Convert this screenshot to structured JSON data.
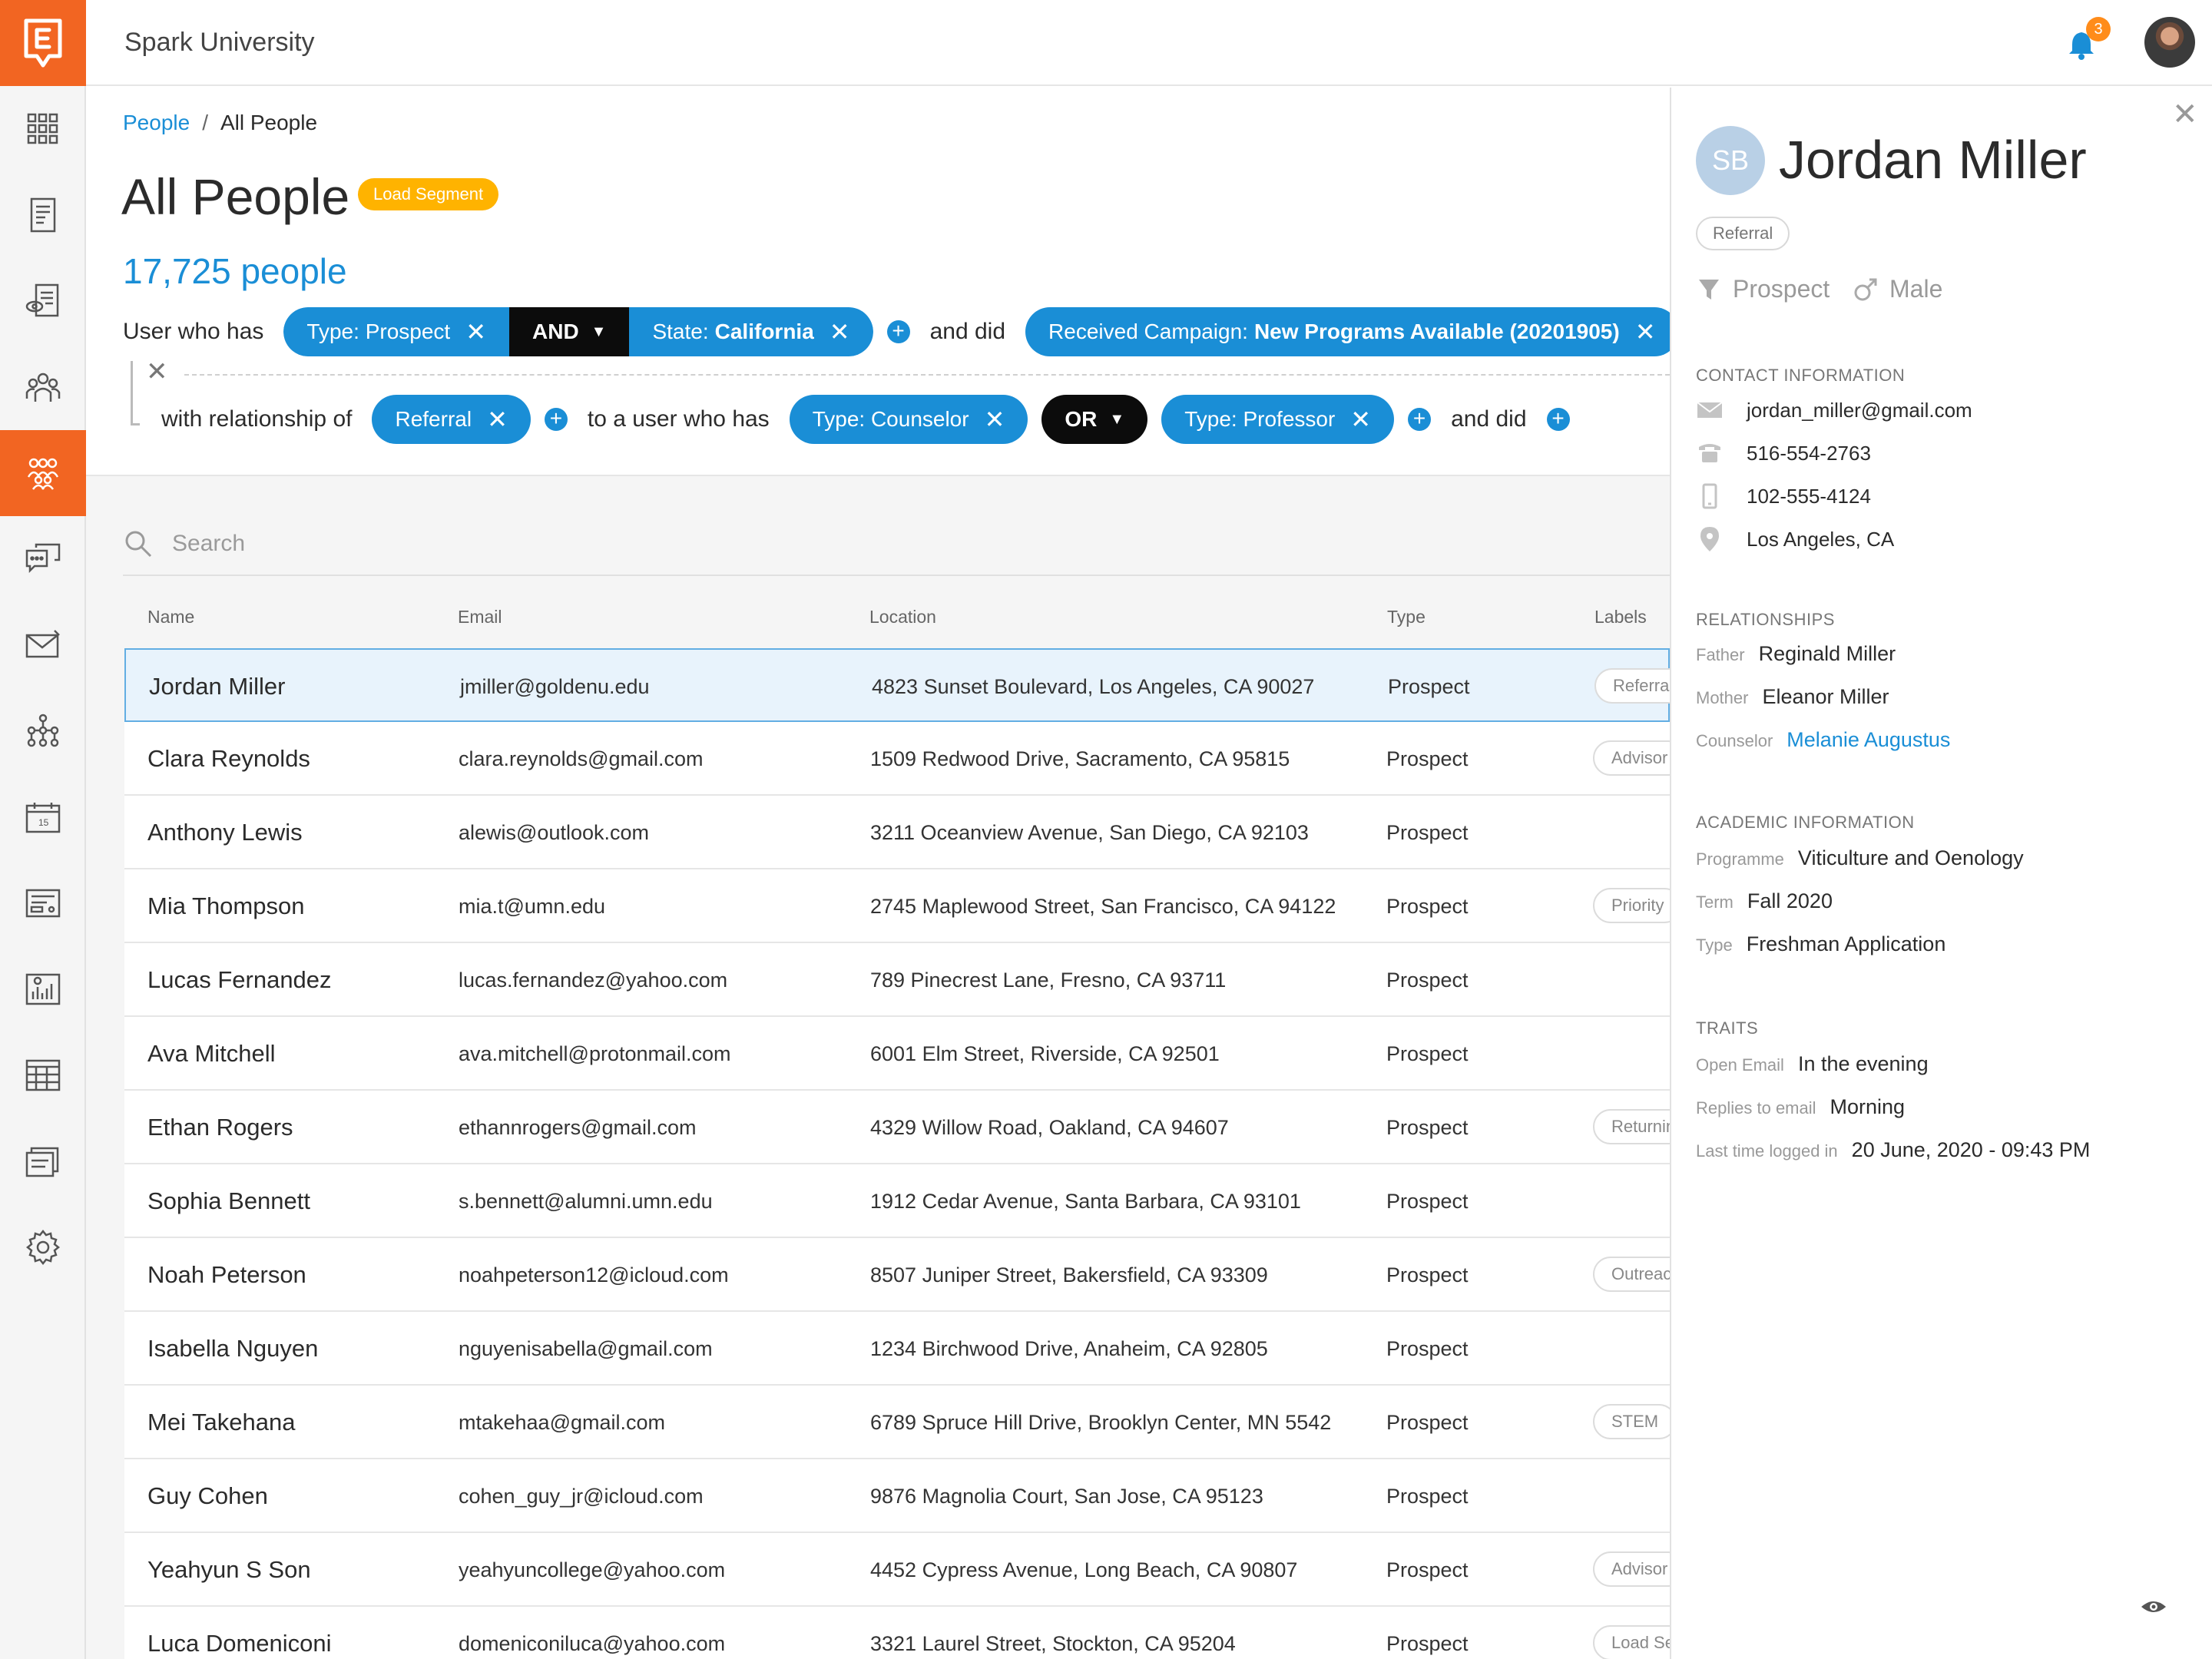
{
  "app": {
    "title": "Spark University",
    "notification_count": "3",
    "accent": "#f26522",
    "link_color": "#1a8ed6"
  },
  "sidebar": {
    "items": [
      {
        "icon": "grid-icon"
      },
      {
        "icon": "document-icon"
      },
      {
        "icon": "document-eye-icon"
      },
      {
        "icon": "team-icon"
      },
      {
        "icon": "people-icon",
        "active": true
      },
      {
        "icon": "chat-icon"
      },
      {
        "icon": "mail-icon"
      },
      {
        "icon": "hierarchy-icon"
      },
      {
        "icon": "calendar-icon"
      },
      {
        "icon": "form-icon"
      },
      {
        "icon": "chart-icon"
      },
      {
        "icon": "table-icon"
      },
      {
        "icon": "files-icon"
      },
      {
        "icon": "gear-icon"
      }
    ]
  },
  "breadcrumb": {
    "parent": "People",
    "separator": "/",
    "current": "All People"
  },
  "page": {
    "title": "All People",
    "load_segment": "Load Segment",
    "count": "17,725 people"
  },
  "filters": {
    "row1": {
      "prefix": "User who has",
      "chip1_key": "Type:",
      "chip1_val": "Prospect",
      "operator": "AND",
      "chip2_key": "State:",
      "chip2_val": "California",
      "and_did": "and did",
      "chip3_key": "Received Campaign:",
      "chip3_val": "New Programs Available (20201905)"
    },
    "row2": {
      "prefix": "with relationship of",
      "rel_chip": "Referral",
      "to_user": "to a user who has",
      "chip1_key": "Type:",
      "chip1_val": "Counselor",
      "operator": "OR",
      "chip2_key": "Type:",
      "chip2_val": "Professor",
      "and_did": "and did"
    }
  },
  "search": {
    "placeholder": "Search"
  },
  "table": {
    "columns": [
      "Name",
      "Email",
      "Location",
      "Type",
      "Labels"
    ],
    "rows": [
      {
        "name": "Jordan Miller",
        "email": "jmiller@goldenu.edu",
        "location": "4823 Sunset Boulevard, Los Angeles, CA 90027",
        "type": "Prospect",
        "label": "Referral"
      },
      {
        "name": "Clara Reynolds",
        "email": "clara.reynolds@gmail.com",
        "location": "1509 Redwood Drive, Sacramento, CA 95815",
        "type": "Prospect",
        "label": "Advisor"
      },
      {
        "name": "Anthony Lewis",
        "email": "alewis@outlook.com",
        "location": "3211 Oceanview Avenue, San Diego, CA 92103",
        "type": "Prospect",
        "label": ""
      },
      {
        "name": "Mia Thompson",
        "email": "mia.t@umn.edu",
        "location": "2745 Maplewood Street, San Francisco, CA 94122",
        "type": "Prospect",
        "label": "Priority"
      },
      {
        "name": "Lucas Fernandez",
        "email": "lucas.fernandez@yahoo.com",
        "location": "789 Pinecrest Lane, Fresno, CA 93711",
        "type": "Prospect",
        "label": ""
      },
      {
        "name": "Ava Mitchell",
        "email": "ava.mitchell@protonmail.com",
        "location": "6001 Elm Street, Riverside, CA 92501",
        "type": "Prospect",
        "label": ""
      },
      {
        "name": "Ethan Rogers",
        "email": "ethannrogers@gmail.com",
        "location": "4329 Willow Road, Oakland, CA 94607",
        "type": "Prospect",
        "label": "Returning"
      },
      {
        "name": "Sophia Bennett",
        "email": "s.bennett@alumni.umn.edu",
        "location": "1912 Cedar Avenue, Santa Barbara, CA 93101",
        "type": "Prospect",
        "label": ""
      },
      {
        "name": "Noah Peterson",
        "email": "noahpeterson12@icloud.com",
        "location": "8507 Juniper Street, Bakersfield, CA 93309",
        "type": "Prospect",
        "label": "Outreach"
      },
      {
        "name": "Isabella Nguyen",
        "email": "nguyenisabella@gmail.com",
        "location": "1234 Birchwood Drive, Anaheim, CA 92805",
        "type": "Prospect",
        "label": ""
      },
      {
        "name": "Mei Takehana",
        "email": "mtakehaa@gmail.com",
        "location": "6789 Spruce Hill Drive, Brooklyn Center, MN 5542",
        "type": "Prospect",
        "label": "STEM"
      },
      {
        "name": "Guy Cohen",
        "email": "cohen_guy_jr@icloud.com",
        "location": "9876 Magnolia Court, San Jose, CA 95123",
        "type": "Prospect",
        "label": ""
      },
      {
        "name": "Yeahyun S Son",
        "email": "yeahyuncollege@yahoo.com",
        "location": "4452 Cypress Avenue, Long Beach, CA 90807",
        "type": "Prospect",
        "label": "Advisor"
      },
      {
        "name": "Luca Domeniconi",
        "email": "domeniconiluca@yahoo.com",
        "location": "3321 Laurel Street, Stockton, CA 95204",
        "type": "Prospect",
        "label": "Load Segment"
      }
    ]
  },
  "panel": {
    "initials": "SB",
    "name": "Jordan Miller",
    "tag": "Referral",
    "status": "Prospect",
    "gender": "Male",
    "contact_title": "CONTACT INFORMATION",
    "email": "jordan_miller@gmail.com",
    "phone": "516-554-2763",
    "mobile": "102-555-4124",
    "location": "Los Angeles, CA",
    "relationships_title": "RELATIONSHIPS",
    "father_k": "Father",
    "father_v": "Reginald Miller",
    "mother_k": "Mother",
    "mother_v": "Eleanor Miller",
    "counselor_k": "Counselor",
    "counselor_v": "Melanie Augustus",
    "academic_title": "ACADEMIC INFORMATION",
    "programme_k": "Programme",
    "programme_v": "Viticulture and Oenology",
    "term_k": "Term",
    "term_v": "Fall 2020",
    "type_k": "Type",
    "type_v": "Freshman Application",
    "traits_title": "TRAITS",
    "open_email_k": "Open Email",
    "open_email_v": "In the evening",
    "replies_k": "Replies to email",
    "replies_v": "Morning",
    "last_login_k": "Last time logged in",
    "last_login_v": "20 June, 2020 - 09:43 PM"
  }
}
